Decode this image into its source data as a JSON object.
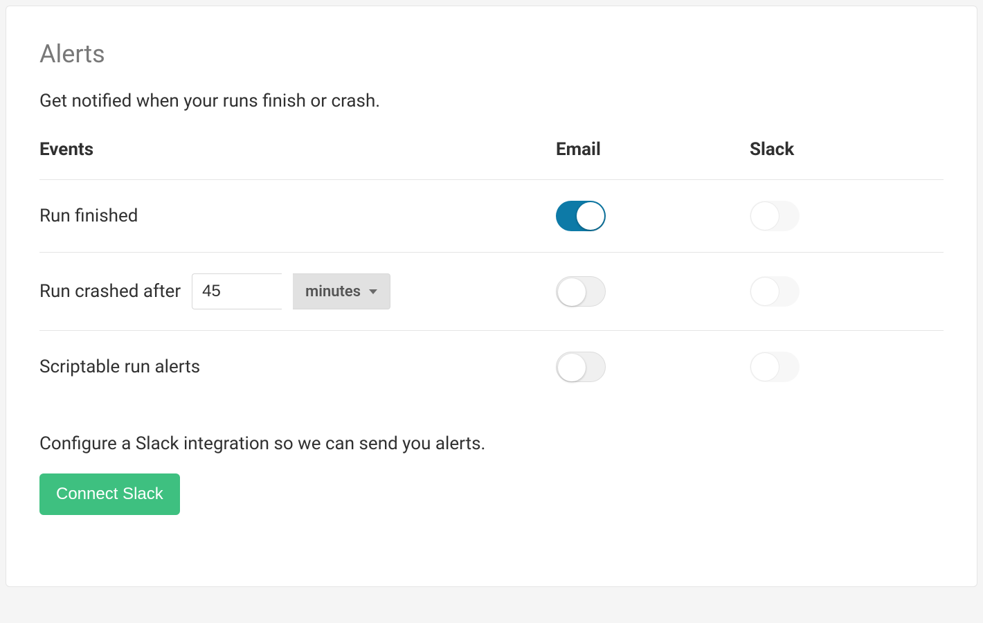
{
  "title": "Alerts",
  "subtitle": "Get notified when your runs finish or crash.",
  "columns": {
    "events": "Events",
    "email": "Email",
    "slack": "Slack"
  },
  "rows": {
    "run_finished": {
      "label": "Run finished",
      "email_on": true,
      "slack_disabled": true
    },
    "run_crashed": {
      "label": "Run crashed after",
      "duration_value": "45",
      "duration_unit": "minutes",
      "email_on": false,
      "slack_disabled": true
    },
    "scriptable": {
      "label": "Scriptable run alerts",
      "email_on": false,
      "slack_disabled": true
    }
  },
  "slack_help": "Configure a Slack integration so we can send you alerts.",
  "connect_button": "Connect Slack"
}
